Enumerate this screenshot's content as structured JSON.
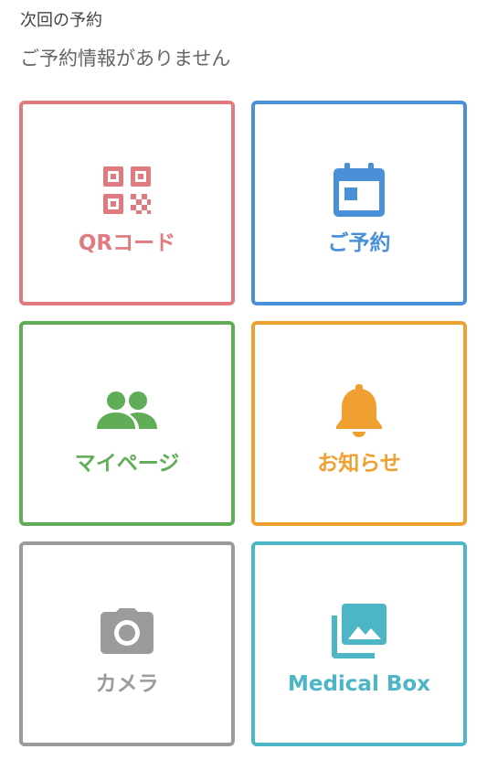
{
  "reservation": {
    "heading": "次回の予約",
    "status": "ご予約情報がありません"
  },
  "tiles": [
    {
      "key": "qr",
      "label": "QRコード",
      "icon": "qr-code-icon",
      "color": "#E07A7E"
    },
    {
      "key": "reserve",
      "label": "ご予約",
      "icon": "calendar-icon",
      "color": "#4A90D9"
    },
    {
      "key": "mypage",
      "label": "マイページ",
      "icon": "people-icon",
      "color": "#5FAD56"
    },
    {
      "key": "notices",
      "label": "お知らせ",
      "icon": "bell-icon",
      "color": "#F0A030"
    },
    {
      "key": "camera",
      "label": "カメラ",
      "icon": "camera-icon",
      "color": "#9B9B9B"
    },
    {
      "key": "medical",
      "label": "Medical Box",
      "icon": "photo-library-icon",
      "color": "#4CB5C6"
    }
  ]
}
